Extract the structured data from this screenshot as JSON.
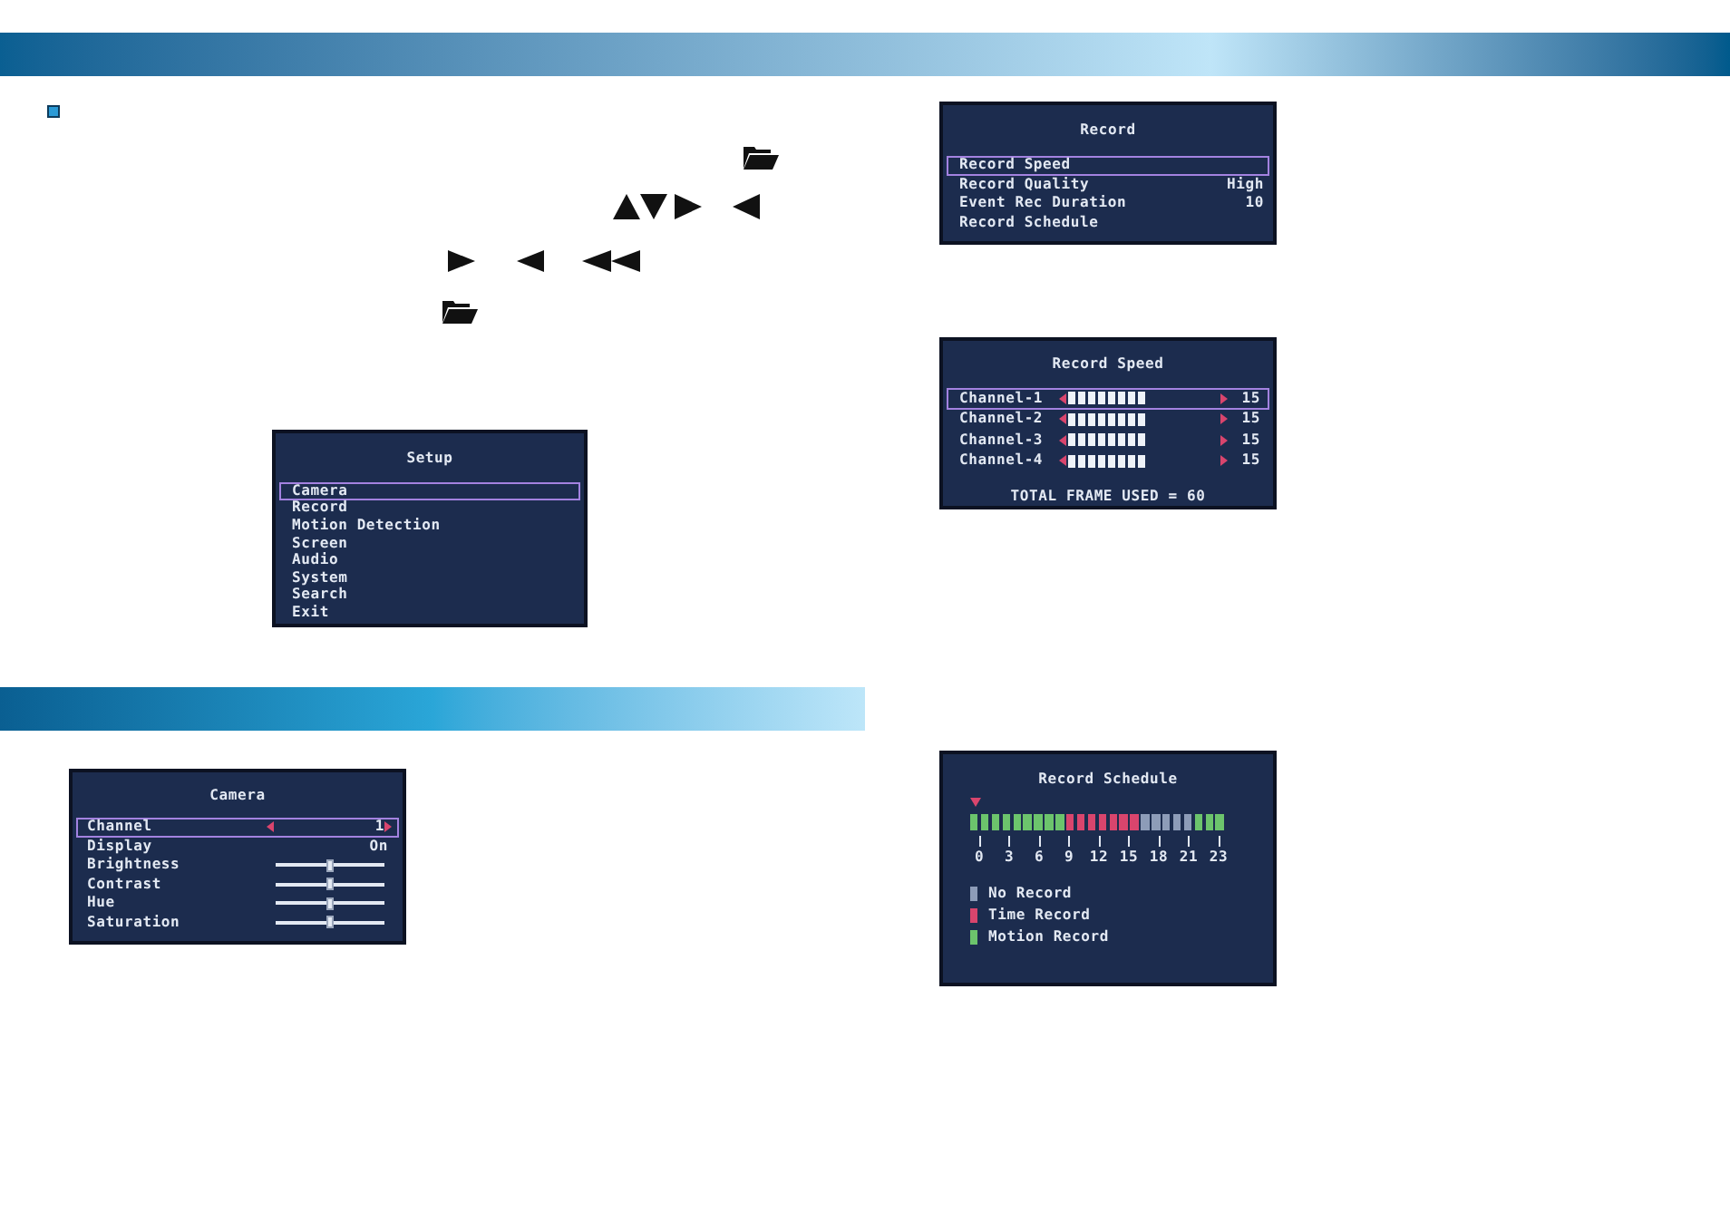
{
  "setup_screen": {
    "title": "Setup",
    "items": [
      {
        "label": "Camera",
        "selected": true
      },
      {
        "label": "Record",
        "selected": false
      },
      {
        "label": "Motion Detection",
        "selected": false
      },
      {
        "label": "Screen",
        "selected": false
      },
      {
        "label": "Audio",
        "selected": false
      },
      {
        "label": "System",
        "selected": false
      },
      {
        "label": "Search",
        "selected": false
      },
      {
        "label": "Exit",
        "selected": false
      }
    ]
  },
  "camera_screen": {
    "title": "Camera",
    "rows": [
      {
        "kind": "selector",
        "label": "Channel",
        "value": "1",
        "selected": true
      },
      {
        "kind": "value",
        "label": "Display",
        "value": "On",
        "selected": false
      },
      {
        "kind": "slider",
        "label": "Brightness",
        "level": 0.5,
        "selected": false
      },
      {
        "kind": "slider",
        "label": "Contrast",
        "level": 0.5,
        "selected": false
      },
      {
        "kind": "slider",
        "label": "Hue",
        "level": 0.5,
        "selected": false
      },
      {
        "kind": "slider",
        "label": "Saturation",
        "level": 0.5,
        "selected": false
      }
    ]
  },
  "record_screen": {
    "title": "Record",
    "items": [
      {
        "label": "Record Speed",
        "selected": true
      },
      {
        "label": "Record Quality",
        "value": "High",
        "selected": false
      },
      {
        "label": "Event Rec Duration",
        "value": "10",
        "selected": false
      },
      {
        "label": "Record Schedule",
        "selected": false
      }
    ]
  },
  "record_speed_screen": {
    "title": "Record Speed",
    "channels": [
      {
        "label": "Channel-1",
        "level": 0.52,
        "value": "15",
        "selected": true
      },
      {
        "label": "Channel-2",
        "level": 0.52,
        "value": "15",
        "selected": false
      },
      {
        "label": "Channel-3",
        "level": 0.52,
        "value": "15",
        "selected": false
      },
      {
        "label": "Channel-4",
        "level": 0.52,
        "value": "15",
        "selected": false
      }
    ],
    "total": "TOTAL FRAME USED = 60"
  },
  "record_schedule_screen": {
    "title": "Record Schedule",
    "slots": [
      {
        "kind": "motion"
      },
      {
        "kind": "motion"
      },
      {
        "kind": "motion"
      },
      {
        "kind": "motion"
      },
      {
        "kind": "motion"
      },
      {
        "kind": "motion"
      },
      {
        "kind": "motion"
      },
      {
        "kind": "motion"
      },
      {
        "kind": "motion"
      },
      {
        "kind": "time"
      },
      {
        "kind": "time"
      },
      {
        "kind": "time"
      },
      {
        "kind": "time"
      },
      {
        "kind": "time"
      },
      {
        "kind": "time"
      },
      {
        "kind": "time"
      },
      {
        "kind": "none"
      },
      {
        "kind": "none"
      },
      {
        "kind": "none"
      },
      {
        "kind": "none"
      },
      {
        "kind": "none"
      },
      {
        "kind": "motion"
      },
      {
        "kind": "motion"
      },
      {
        "kind": "motion"
      }
    ],
    "hour_labels": [
      "0",
      "3",
      "6",
      "9",
      "12",
      "15",
      "18",
      "21",
      "23"
    ],
    "legend": [
      {
        "kind": "none",
        "label": "No Record",
        "color": "#8d9cb8"
      },
      {
        "kind": "time",
        "label": "Time Record",
        "color": "#d9456d"
      },
      {
        "kind": "motion",
        "label": "Motion Record",
        "color": "#6cc46c"
      }
    ]
  }
}
